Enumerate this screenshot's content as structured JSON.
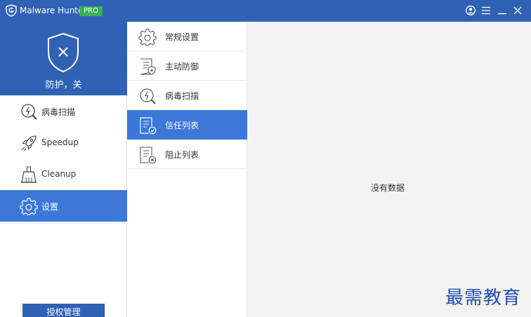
{
  "app": {
    "title": "Malware Hunter",
    "badge": "PRO"
  },
  "titlebar": {
    "icons": [
      "user-icon",
      "menu-icon",
      "minimize-icon",
      "close-icon"
    ]
  },
  "protection": {
    "status": "防护，关",
    "icon": "shield-x-icon"
  },
  "sidebar": {
    "items": [
      {
        "label": "病毒扫描",
        "icon": "virus-scan-icon",
        "active": false
      },
      {
        "label": "Speedup",
        "icon": "rocket-icon",
        "active": false
      },
      {
        "label": "Cleanup",
        "icon": "broom-icon",
        "active": false
      },
      {
        "label": "设置",
        "icon": "gear-icon",
        "active": true
      }
    ],
    "license_button": "授权管理"
  },
  "settings_menu": {
    "items": [
      {
        "label": "常规设置",
        "icon": "gear-icon",
        "active": false
      },
      {
        "label": "主动防御",
        "icon": "shield-doc-icon",
        "active": false
      },
      {
        "label": "病毒扫描",
        "icon": "virus-scan-icon",
        "active": false
      },
      {
        "label": "信任列表",
        "icon": "trust-list-icon",
        "active": true
      },
      {
        "label": "阻止列表",
        "icon": "block-list-icon",
        "active": false
      }
    ]
  },
  "main": {
    "empty_text": "没有数据"
  },
  "watermark": "最需教育",
  "colors": {
    "brand": "#2f62b4",
    "active": "#3b78d8",
    "pro_badge": "#3db05b",
    "background": "#f3f3f3",
    "watermark": "#1f4fb3"
  }
}
